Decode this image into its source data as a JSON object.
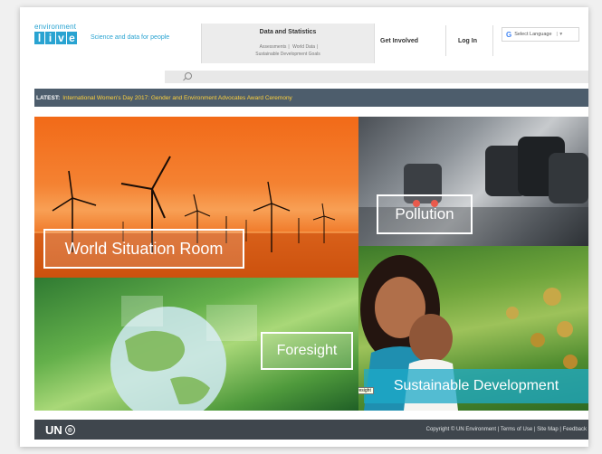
{
  "header": {
    "logo_top": "environment",
    "logo_letters": [
      "l",
      "i",
      "v",
      "e"
    ],
    "tagline": "Science and data for people",
    "data_stats": {
      "title": "Data and Statistics",
      "links": [
        "Assessments",
        "World Data",
        "Sustainable Development Goals"
      ]
    },
    "get_involved": "Get Involved",
    "login": "Log In",
    "language": "Select Language"
  },
  "latest": {
    "label": "LATEST:",
    "text": "International Women's Day 2017: Gender and Environment Advocates Award Ceremony"
  },
  "tiles": {
    "world": "World Situation Room",
    "pollution": "Pollution",
    "foresight": "Foresight",
    "sustainable": "Sustainable Development",
    "tooltip": "Foresight"
  },
  "footer": {
    "un": "UN",
    "links": "Copyright © UN Environment | Terms of Use | Site Map | Feedback"
  },
  "colors": {
    "brand": "#29a3d1",
    "latest_bar": "#4d5d6c",
    "news_link": "#ffd23c",
    "footer": "#3f464d"
  }
}
